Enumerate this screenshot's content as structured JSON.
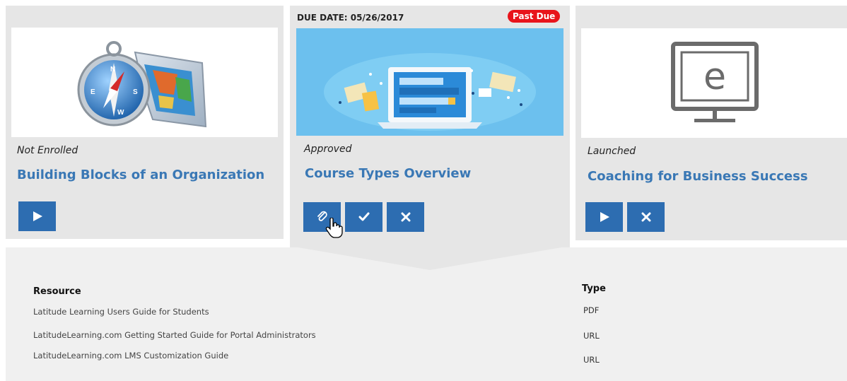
{
  "cards": [
    {
      "status": "Not Enrolled",
      "title": "Building Blocks of an Organization",
      "thumb_icon": "compass-map-icon"
    },
    {
      "due_date": "DUE DATE: 05/26/2017",
      "badge": "Past Due",
      "status": "Approved",
      "title": "Course Types Overview",
      "thumb_icon": "laptop-course-icon"
    },
    {
      "status": "Launched",
      "title": "Coaching for Business Success",
      "thumb_icon": "elearning-monitor-icon"
    }
  ],
  "resources": {
    "header_resource": "Resource",
    "header_type": "Type",
    "rows": [
      {
        "name": "Latitude Learning Users Guide for Students",
        "type": "PDF"
      },
      {
        "name": "LatitudeLearning.com Getting Started Guide for Portal Administrators",
        "type": "URL"
      },
      {
        "name": "LatitudeLearning.com LMS Customization Guide",
        "type": "URL"
      }
    ]
  },
  "colors": {
    "accent": "#2d6db1",
    "title": "#3a78b5",
    "past_due": "#e8141b",
    "card_bg": "#e6e6e6",
    "panel_bg": "#f0f0f0"
  }
}
